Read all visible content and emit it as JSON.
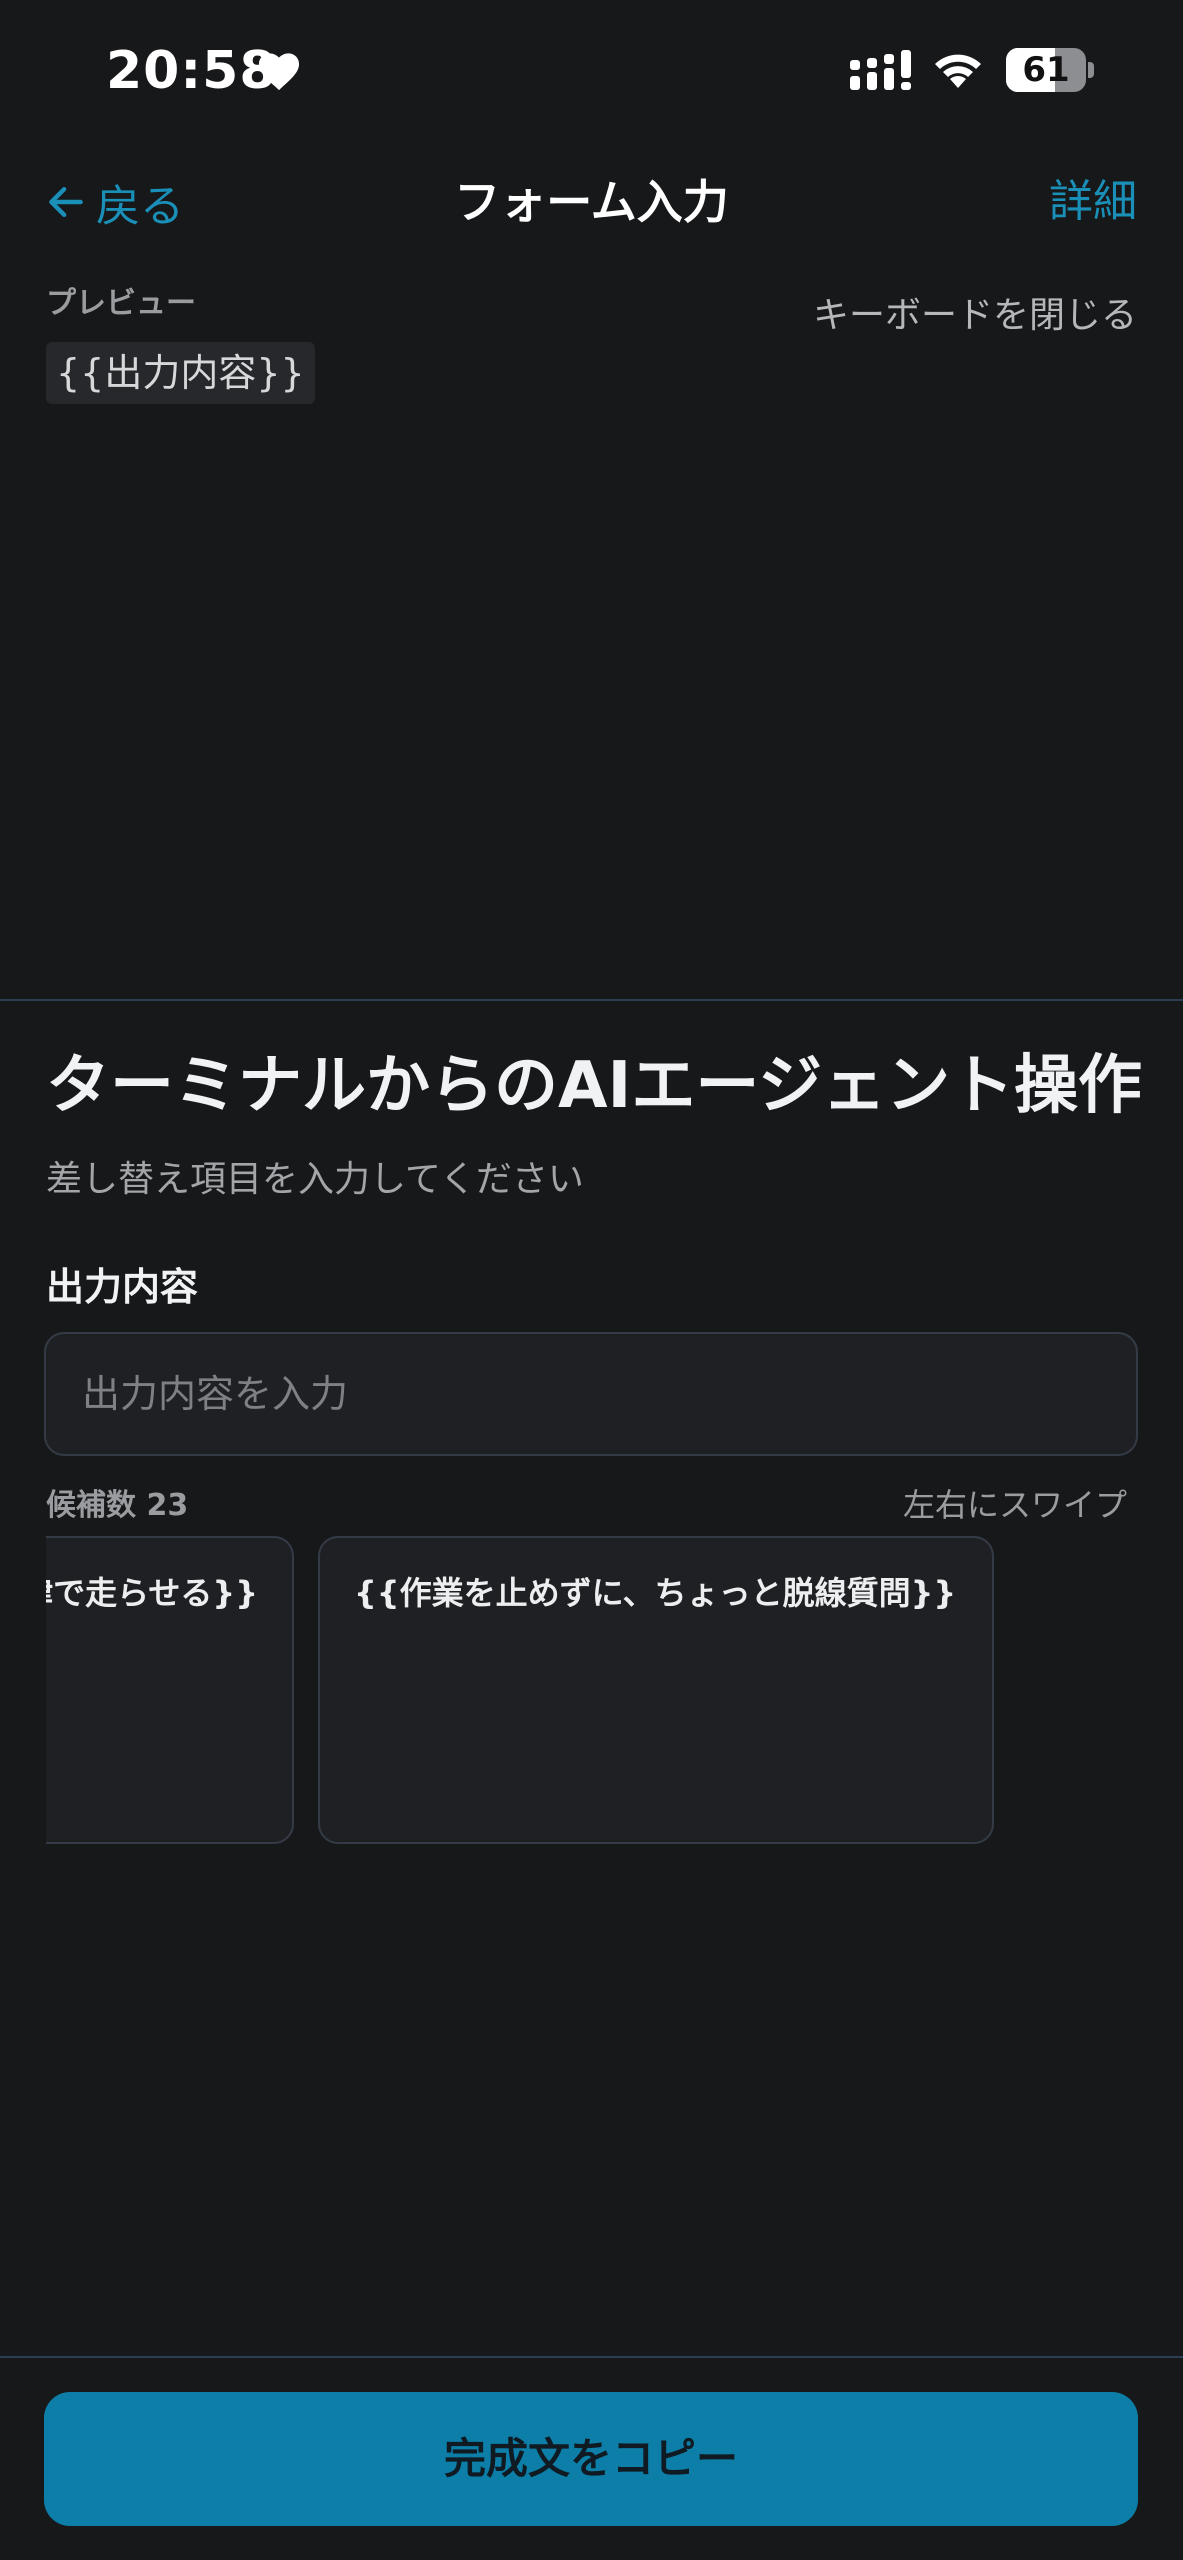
{
  "status_bar": {
    "time": "20:58",
    "battery_level": "61",
    "battery_fraction": 0.61,
    "icons": [
      "heart-icon",
      "signal-icon",
      "wifi-icon",
      "battery-icon"
    ]
  },
  "nav": {
    "back_label": "戻る",
    "title": "フォーム入力",
    "detail_label": "詳細"
  },
  "preview": {
    "label": "プレビュー",
    "dismiss_keyboard_label": "キーボードを閉じる",
    "content": "{{出力内容}}"
  },
  "form": {
    "title": "ターミナルからのAIエージェント操作",
    "subtitle": "差し替え項目を入力してください",
    "field_label": "出力内容",
    "field_placeholder": "出力内容を入力",
    "field_value": ""
  },
  "candidates": {
    "count_label": "候補数 23",
    "swipe_hint": "左右にスワイプ",
    "items": [
      "律で走らせる}}",
      "{{作業を止めずに、ちょっと脱線質問}}"
    ]
  },
  "footer": {
    "copy_button_label": "完成文をコピー"
  },
  "colors": {
    "background": "#17181a",
    "accent": "#1a8fb8",
    "button": "#0c7ea8",
    "card_border": "#343b46"
  }
}
